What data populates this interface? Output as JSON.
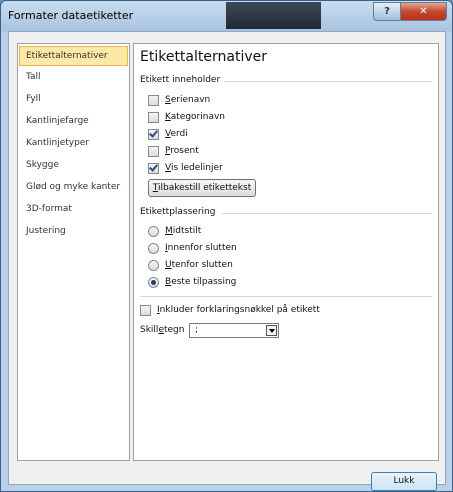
{
  "window": {
    "title": "Formater dataetiketter",
    "help": "?",
    "close": "✕"
  },
  "sidebar": {
    "items": [
      {
        "label": "Etikettalternativer",
        "active": true
      },
      {
        "label": "Tall"
      },
      {
        "label": "Fyll"
      },
      {
        "label": "Kantlinjefarge"
      },
      {
        "label": "Kantlinjetyper"
      },
      {
        "label": "Skygge"
      },
      {
        "label": "Glød og myke kanter"
      },
      {
        "label": "3D-format"
      },
      {
        "label": "Justering"
      }
    ]
  },
  "panel": {
    "title": "Etikettalternativer",
    "contains_label": "Etikett inneholder",
    "contains": [
      {
        "key": "S",
        "rest": "erienavn",
        "checked": false
      },
      {
        "key": "K",
        "rest": "ategorinavn",
        "checked": false
      },
      {
        "key": "V",
        "rest": "erdi",
        "checked": true
      },
      {
        "key": "P",
        "rest": "rosent",
        "checked": false
      },
      {
        "key": "V",
        "rest": "is ledelinjer",
        "checked": true
      }
    ],
    "reset_key": "T",
    "reset_rest": "ilbakestill etikettekst",
    "placement_label": "Etikettplassering",
    "placements": [
      {
        "key": "M",
        "rest": "idtstilt",
        "checked": false
      },
      {
        "key": "I",
        "rest": "nnenfor slutten",
        "checked": false
      },
      {
        "key": "U",
        "rest": "tenfor slutten",
        "checked": false
      },
      {
        "key": "B",
        "rest": "este tilpassing",
        "checked": true
      }
    ],
    "legend_key_opt": {
      "key": "I",
      "rest": "nkluder forklaringsnøkkel på etikett",
      "checked": false
    },
    "separator_pre": "Skill",
    "separator_key": "e",
    "separator_post": "tegn",
    "separator_value": ";"
  },
  "footer": {
    "close_label": "Lukk"
  }
}
